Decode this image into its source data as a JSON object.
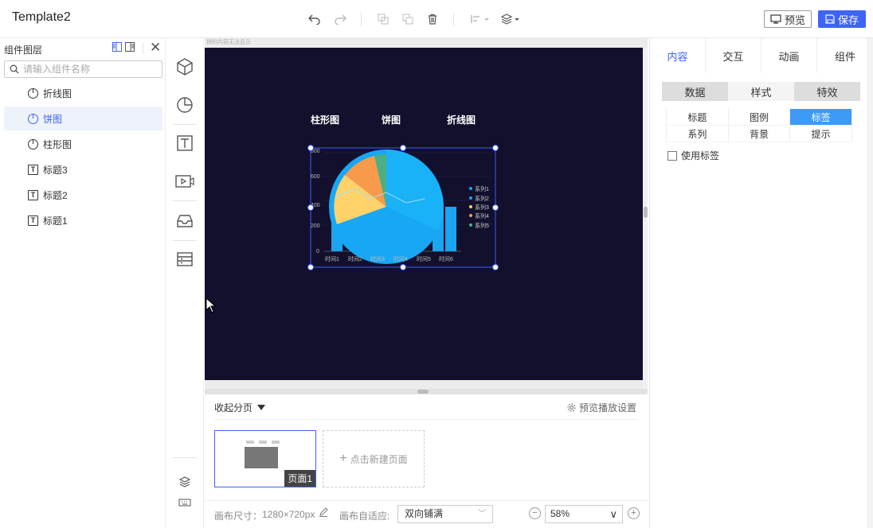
{
  "app": {
    "title": "Template2"
  },
  "toolbar": {
    "undo_icon": "undo-icon",
    "redo_icon": "redo-icon",
    "copy_icon": "copy-icon",
    "paste_icon": "paste-icon",
    "delete_icon": "trash-icon",
    "align_icon": "align-icon",
    "layer_icon": "layers-icon",
    "preview_label": "预览",
    "save_label": "保存"
  },
  "layers": {
    "header": "组件图层",
    "search_placeholder": "请输入组件名称",
    "items": [
      {
        "label": "折线图",
        "icon": "pie",
        "active": false
      },
      {
        "label": "饼图",
        "icon": "pie",
        "active": true
      },
      {
        "label": "柱形图",
        "icon": "pie",
        "active": false
      },
      {
        "label": "标题3",
        "icon": "text",
        "active": false
      },
      {
        "label": "标题2",
        "icon": "text",
        "active": false
      },
      {
        "label": "标题1",
        "icon": "text",
        "active": false
      }
    ]
  },
  "canvas": {
    "ruler_text": "拼的内容无法显示",
    "titles": [
      "柱形图",
      "饼图",
      "折线图"
    ],
    "legend": [
      "系列1",
      "系列2",
      "系列3",
      "系列4",
      "系列5"
    ],
    "x_labels": [
      "时间1",
      "时间2",
      "时间3",
      "时间4",
      "时间5",
      "时间6"
    ],
    "y_labels": [
      "800",
      "600",
      "400",
      "200",
      "0"
    ]
  },
  "pages": {
    "collapse_label": "收起分页",
    "play_settings_label": "预览播放设置",
    "page_label": "页面1",
    "new_page_label": "点击新建页面",
    "canvas_size_label": "画布尺寸：",
    "canvas_size_value": "1280×720px",
    "fit_label": "画布自适应:",
    "fit_value": "双向铺满",
    "zoom_value": "58%"
  },
  "right_panel": {
    "tabs": [
      "内容",
      "交互",
      "动画",
      "组件"
    ],
    "subtabs": [
      "数据",
      "样式",
      "特效"
    ],
    "grid": [
      [
        "标题",
        "图例",
        "标签"
      ],
      [
        "系列",
        "背景",
        "提示"
      ]
    ],
    "selected_cell": "标签",
    "checkbox_label": "使用标签"
  }
}
